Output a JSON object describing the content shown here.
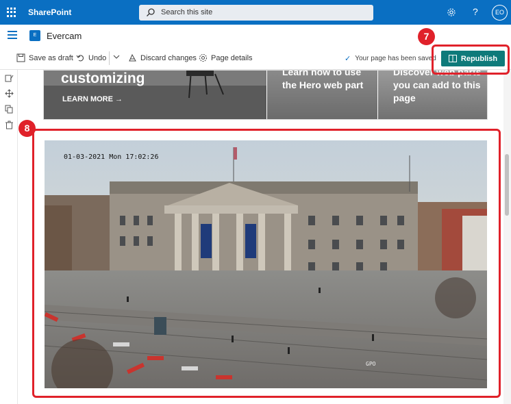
{
  "suite_bar": {
    "app_name": "SharePoint",
    "search_placeholder": "Search this site",
    "settings_icon": "gear-icon",
    "help_label": "?",
    "user_initials": "EO"
  },
  "site": {
    "logo_letter": "E",
    "name": "Evercam"
  },
  "command_bar": {
    "save_draft": "Save as draft",
    "undo": "Undo",
    "discard": "Discard changes",
    "page_details": "Page details",
    "status": "Your page has been saved",
    "republish": "Republish"
  },
  "hero_tiles": [
    {
      "title": "customizing",
      "link": "LEARN MORE →"
    },
    {
      "title": "Learn how to use the Hero web part"
    },
    {
      "title": "Discover web parts you can add to this page"
    }
  ],
  "webcam": {
    "timestamp": "01-03-2021 Mon 17:02:26",
    "label": "GPO"
  },
  "annotations": {
    "badge_7": "7",
    "badge_8": "8"
  },
  "colors": {
    "suite_bar": "#0a6fc2",
    "republish": "#0e7a7a",
    "annotation": "#e0212a"
  }
}
